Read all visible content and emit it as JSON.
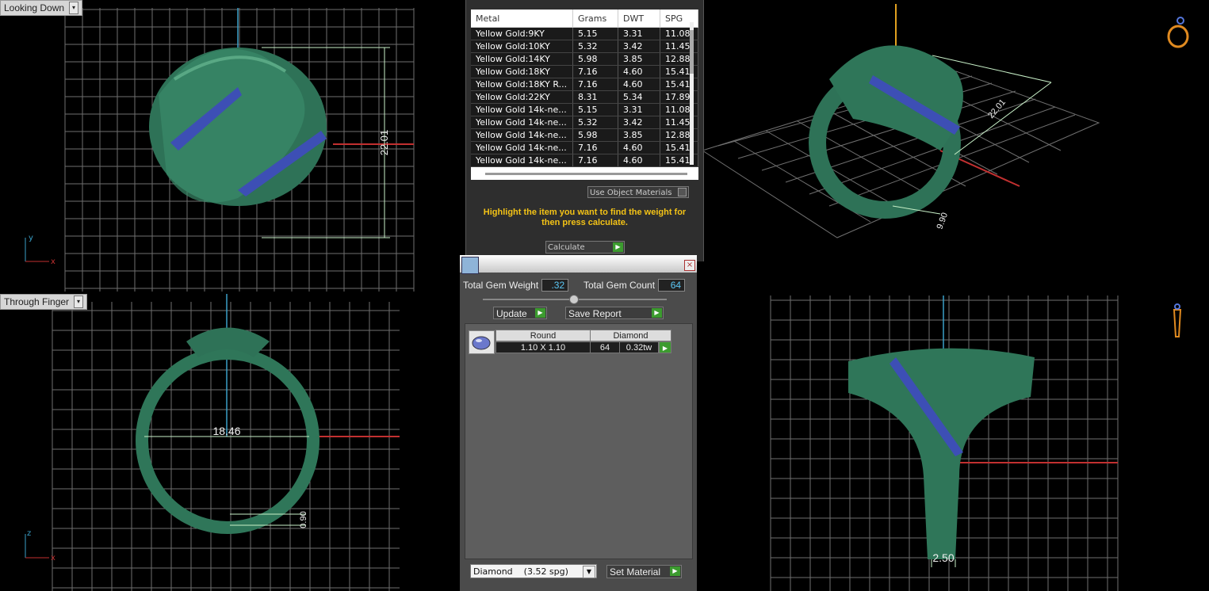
{
  "viewports": {
    "top_left": {
      "label": "Looking Down",
      "dimension": "22.01"
    },
    "top_right": {
      "dimension_a": "22.01",
      "dimension_b": "9.90"
    },
    "bottom_left": {
      "label": "Through Finger",
      "dimension_a": "18.46",
      "dimension_b": "0.90"
    },
    "bottom_right": {
      "dimension": "2.50"
    }
  },
  "weight_panel": {
    "columns": [
      "Metal",
      "Grams",
      "DWT",
      "SPG"
    ],
    "rows": [
      [
        "Yellow Gold:9KY",
        "5.15",
        "3.31",
        "11.08"
      ],
      [
        "Yellow Gold:10KY",
        "5.32",
        "3.42",
        "11.45"
      ],
      [
        "Yellow Gold:14KY",
        "5.98",
        "3.85",
        "12.88"
      ],
      [
        "Yellow Gold:18KY",
        "7.16",
        "4.60",
        "15.41"
      ],
      [
        "Yellow Gold:18KY R...",
        "7.16",
        "4.60",
        "15.41"
      ],
      [
        "Yellow Gold:22KY",
        "8.31",
        "5.34",
        "17.89"
      ],
      [
        "Yellow Gold 14k-ne...",
        "5.15",
        "3.31",
        "11.08"
      ],
      [
        "Yellow Gold 14k-ne...",
        "5.32",
        "3.42",
        "11.45"
      ],
      [
        "Yellow Gold 14k-ne...",
        "5.98",
        "3.85",
        "12.88"
      ],
      [
        "Yellow Gold 14k-ne...",
        "7.16",
        "4.60",
        "15.41"
      ],
      [
        "Yellow Gold 14k-ne...",
        "7.16",
        "4.60",
        "15.41"
      ]
    ],
    "use_object_materials": "Use Object Materials",
    "hint": "Highlight the item you want to find the weight for then press calculate.",
    "calculate": "Calculate"
  },
  "gem_panel": {
    "total_gem_weight_label": "Total Gem Weight",
    "total_gem_weight": ".32",
    "total_gem_count_label": "Total Gem Count",
    "total_gem_count": "64",
    "update": "Update",
    "save_report": "Save Report",
    "table_headers": [
      "Round",
      "Diamond"
    ],
    "row": {
      "size": "1.10 X 1.10",
      "count": "64",
      "weight": "0.32tw"
    },
    "material_select": "Diamond    (3.52 spg)",
    "set_material": "Set Material"
  },
  "colors": {
    "ring_green": "#2f7a5c",
    "gem_blue": "#3d4fb5",
    "grid": "#7a7a7a",
    "accent_yellow": "#f4c316"
  }
}
